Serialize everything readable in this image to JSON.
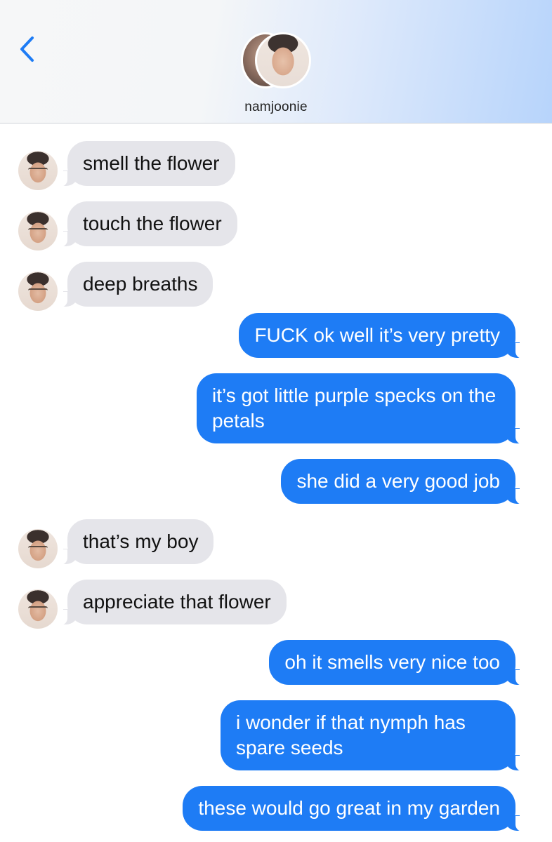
{
  "header": {
    "back_icon": "chevron-left-icon",
    "contact_name": "namjoonie",
    "accent_color": "#1e7cf5"
  },
  "messages": [
    {
      "direction": "incoming",
      "text": "smell the flower"
    },
    {
      "direction": "incoming",
      "text": "touch the flower"
    },
    {
      "direction": "incoming",
      "text": "deep breaths"
    },
    {
      "direction": "outgoing",
      "text": "FUCK ok well it’s very pretty"
    },
    {
      "direction": "outgoing",
      "text": "it’s got little purple specks on the petals"
    },
    {
      "direction": "outgoing",
      "text": "she did a very good job"
    },
    {
      "direction": "incoming",
      "text": "that’s my boy"
    },
    {
      "direction": "incoming",
      "text": "appreciate that flower"
    },
    {
      "direction": "outgoing",
      "text": "oh it smells very nice too"
    },
    {
      "direction": "outgoing",
      "text": "i wonder if that nymph has spare seeds"
    },
    {
      "direction": "outgoing",
      "text": "these would go great in my garden"
    }
  ]
}
